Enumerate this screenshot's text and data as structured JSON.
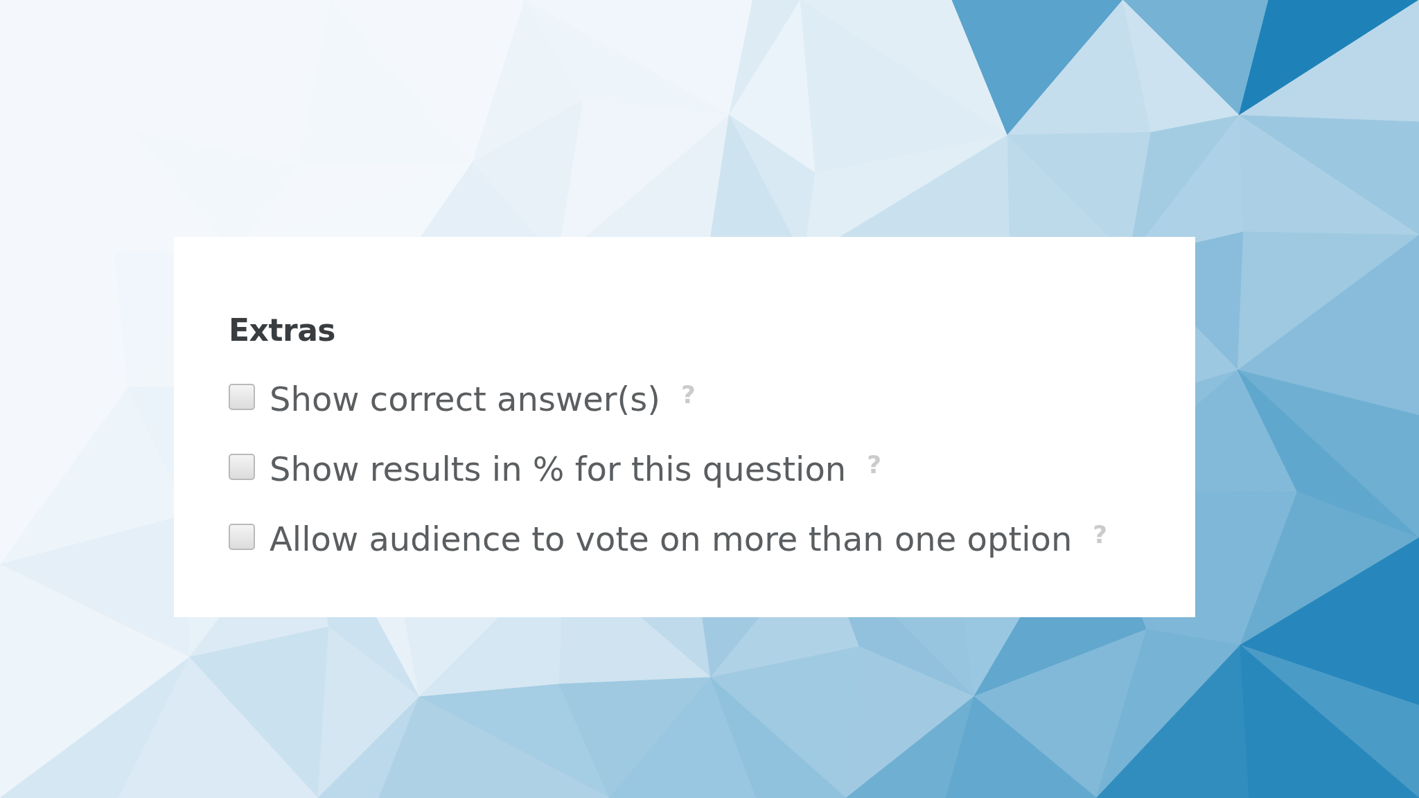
{
  "section": {
    "title": "Extras"
  },
  "options": [
    {
      "label": "Show correct answer(s)",
      "checked": false,
      "help": "?"
    },
    {
      "label": "Show results in % for this question",
      "checked": false,
      "help": "?"
    },
    {
      "label": "Allow audience to vote on more than one option",
      "checked": false,
      "help": "?"
    }
  ]
}
